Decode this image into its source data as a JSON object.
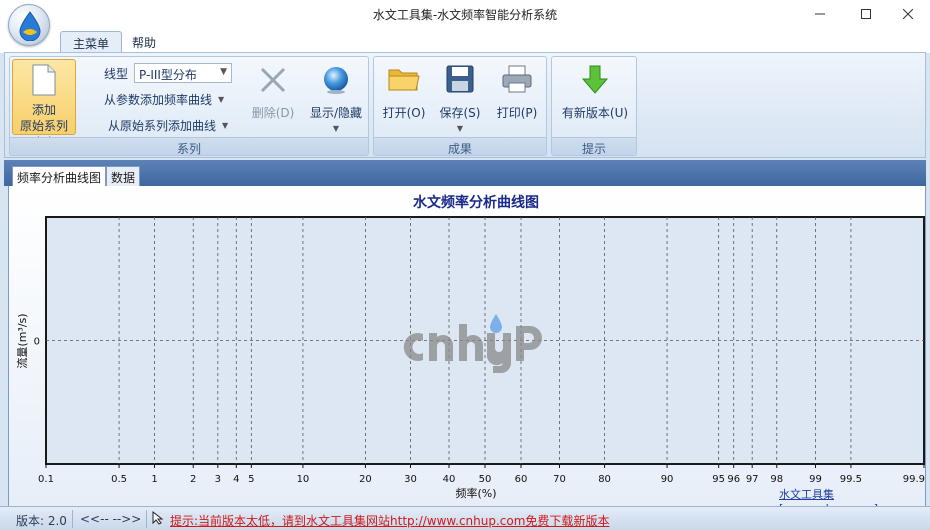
{
  "window": {
    "title": "水文工具集-水文频率智能分析系统"
  },
  "ribbon": {
    "tabs": [
      {
        "label": "主菜单"
      },
      {
        "label": "帮助"
      }
    ],
    "groups": {
      "series": {
        "caption": "系列",
        "add_line1": "添加",
        "add_line2": "原始系列(A)",
        "type_label": "线型",
        "type_value": "P-III型分布",
        "add_from_param": "从参数添加频率曲线",
        "add_from_raw": "从原始系列添加曲线",
        "delete": "删除(D)",
        "show_hide": "显示/隐藏"
      },
      "result": {
        "caption": "成果",
        "open": "打开(O)",
        "save": "保存(S)",
        "print": "打印(P)"
      },
      "tip": {
        "caption": "提示",
        "new_version": "有新版本(U)"
      }
    }
  },
  "doc_tabs": [
    {
      "label": "频率分析曲线图"
    },
    {
      "label": "数据"
    }
  ],
  "chart_data": {
    "type": "line",
    "title": "水文频率分析曲线图",
    "xlabel": "频率(%)",
    "ylabel": "流量(m³/s)",
    "x_scale": "probability",
    "x_ticks": [
      0.1,
      0.5,
      1,
      2,
      3,
      4,
      5,
      10,
      20,
      30,
      40,
      50,
      60,
      70,
      80,
      90,
      95,
      96,
      97,
      98,
      99,
      99.5,
      99.9
    ],
    "x_tick_labels": [
      "0.1",
      "0.5",
      "1",
      "2",
      "3",
      "4",
      "5",
      "10",
      "20",
      "30",
      "40",
      "50",
      "60",
      "70",
      "80",
      "90",
      "95",
      "96",
      "97",
      "98",
      "99",
      "99.5",
      "99.9"
    ],
    "y_ticks": [
      0
    ],
    "y_tick_labels": [
      "0"
    ],
    "series": [],
    "grid": true
  },
  "watermark": {
    "logo": "cnhup",
    "link": "水文工具集[www.cnhup.com]"
  },
  "status": {
    "version": "版本: 2.0",
    "nav": "<<--   -->>",
    "tip": "提示:当前版本太低，请到水文工具集网站http://www.cnhup.com免费下载新版本"
  },
  "colors": {
    "accent": "#3f679f",
    "tip_text": "#d01818",
    "title_text": "#1a2a8a"
  }
}
